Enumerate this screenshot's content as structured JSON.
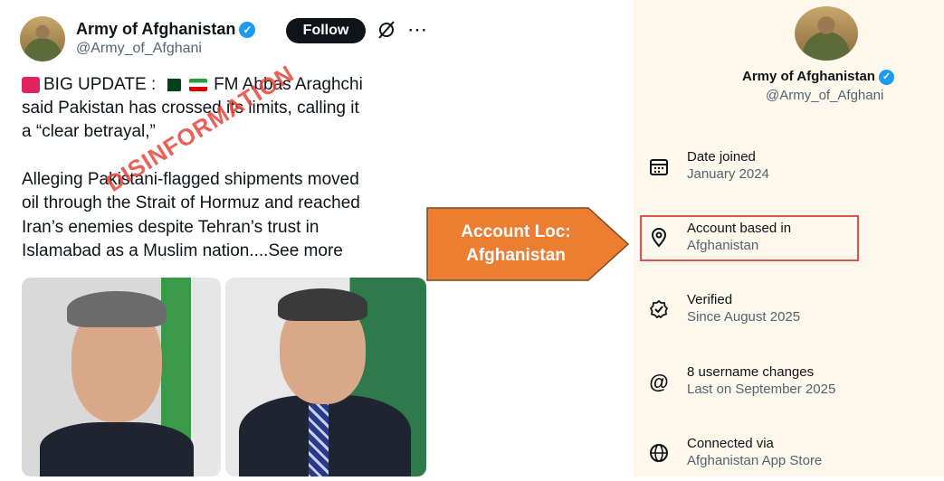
{
  "tweet": {
    "author_name": "Army of Afghanistan",
    "author_handle": "@Army_of_Afghani",
    "follow_label": "Follow",
    "line1": "BIG UPDATE :",
    "line1_rest": "FM Abbas Araghchi",
    "line2": "said Pakistan has crossed its limits, calling it",
    "line3": "a “clear betrayal,”",
    "line4": "Alleging Pakistani-flagged shipments moved",
    "line5": "oil through the Strait of Hormuz and reached",
    "line6": "Iran’s enemies despite Tehran’s trust in",
    "line7": "Islamabad as a Muslim nation....",
    "see_more": "See more",
    "more_icon": "⋯"
  },
  "stamp": {
    "text": "DISINFORMATION",
    "color": "#e8453c"
  },
  "callout": {
    "line1": "Account Loc:",
    "line2": "Afghanistan",
    "color": "#ed7d31"
  },
  "profile_panel": {
    "name": "Army of Afghanistan",
    "handle": "@Army_of_Afghani",
    "rows": [
      {
        "icon": "calendar-icon",
        "title": "Date joined",
        "subtitle": "January 2024"
      },
      {
        "icon": "location-pin-icon",
        "title": "Account based in",
        "subtitle": "Afghanistan"
      },
      {
        "icon": "verified-badge-icon",
        "title": "Verified",
        "subtitle": "Since August 2025"
      },
      {
        "icon": "at-sign-icon",
        "title": "8 username changes",
        "subtitle": "Last on September 2025"
      },
      {
        "icon": "globe-icon",
        "title": "Connected via",
        "subtitle": "Afghanistan App Store"
      }
    ]
  },
  "colors": {
    "verified": "#1d9bf0",
    "highlight_border": "#e0524c",
    "panel_bg": "#fdf7ec"
  }
}
